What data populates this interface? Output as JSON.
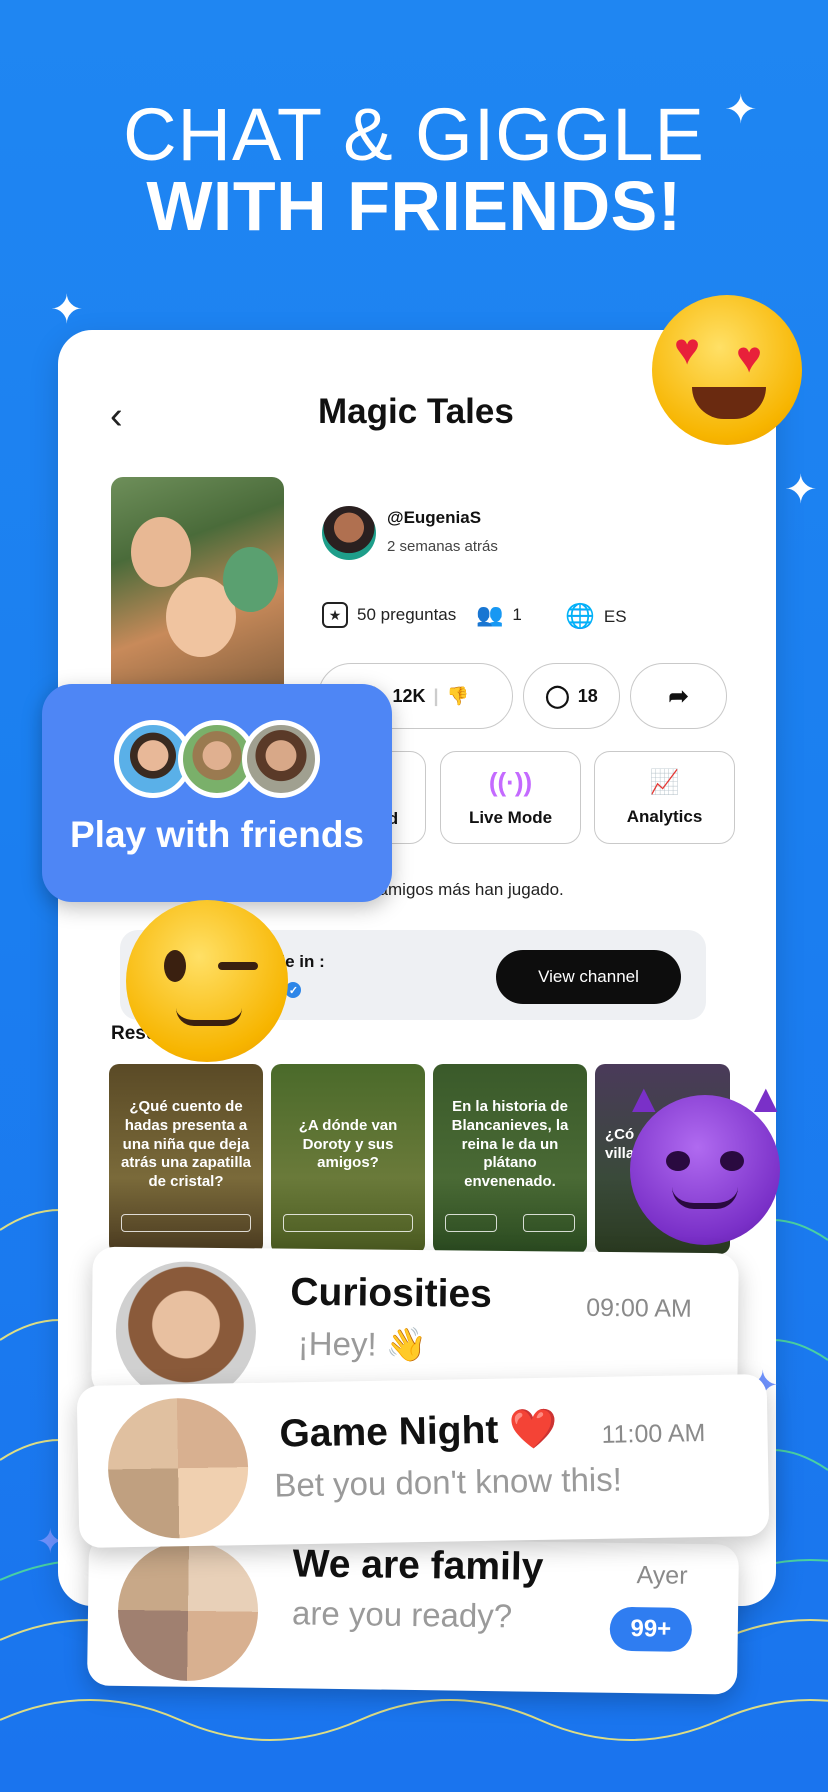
{
  "headline": {
    "line1": "CHAT & GIGGLE",
    "line2": "WITH FRIENDS!"
  },
  "screen": {
    "back_icon": "chevron-left-icon",
    "title": "Magic Tales",
    "author": {
      "username": "@EugeniaS",
      "posted": "2 semanas atrás"
    },
    "stats": {
      "questions": "50 preguntas",
      "players": "1",
      "language": "ES"
    },
    "reactions": {
      "likes": "12K",
      "comments": "18"
    },
    "tiles": [
      {
        "label": "d",
        "icon": "board-icon"
      },
      {
        "label": "Live Mode",
        "icon": "live-broadcast-icon"
      },
      {
        "label": "Analytics",
        "icon": "analytics-chart-icon"
      }
    ],
    "played_text": "aron.lee y 8 amigos más han jugado.",
    "channel": {
      "available_label": "ble in :",
      "name": "y",
      "button": "View channel"
    },
    "section_title": "Resu            episodio",
    "episodes": [
      {
        "question": "¿Qué cuento de hadas presenta a una niña que deja atrás una zapatilla de cristal?",
        "color": "#6b5a2e"
      },
      {
        "question": "¿A dónde van Doroty y sus amigos?",
        "color": "#5a6a2a"
      },
      {
        "question": "En la historia de Blancanieves, la reina le da un plátano envenenado.",
        "color": "#3a5a30"
      },
      {
        "question": "¿Có villa",
        "color": "#4a3a5a"
      }
    ]
  },
  "play_with_friends": {
    "label": "Play with friends"
  },
  "chats": [
    {
      "name": "Curiosities",
      "message": "¡Hey! 👋",
      "time": "09:00 AM"
    },
    {
      "name": "Game Night ❤️",
      "message": "Bet you don't know this!",
      "time": "11:00 AM"
    },
    {
      "name": "We are family",
      "message": "are you ready?",
      "time": "Ayer",
      "badge": "99+"
    }
  ],
  "emojis": [
    "heart-eyes-emoji",
    "winking-emoji",
    "smiling-devil-emoji"
  ],
  "colors": {
    "background": "#1b7ff0",
    "accent": "#2f7df1",
    "play_card": "#4e86f5",
    "button_dark": "#0d0d0d"
  }
}
